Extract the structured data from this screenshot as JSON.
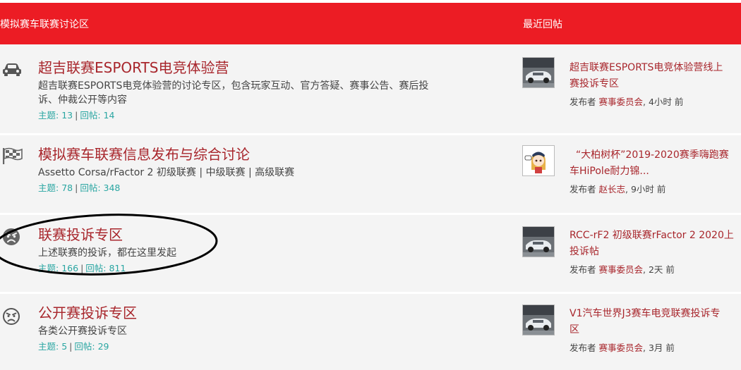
{
  "header": {
    "forum_name": "模拟赛车联赛讨论区",
    "recent_label": "最近回帖"
  },
  "forums": [
    {
      "icon": "car-icon",
      "title": "超吉联赛ESPORTS电竞体验营",
      "description": "超吉联赛ESPORTS电竞体验营的讨论专区，包含玩家互动、官方答疑、赛事公告、赛后投\n诉、仲裁公开等内容",
      "topics_label": "主题:",
      "topics": "13",
      "posts_label": "回帖:",
      "posts": "14",
      "latest": {
        "avatar": "race-car-thumbnail",
        "title": "超吉联赛ESPORTS电竞体验营线上\n赛投诉专区",
        "by_label": "发布者",
        "author": "赛事委员会",
        "time": "4小时 前"
      }
    },
    {
      "icon": "checkered-flag-icon",
      "title": "模拟赛车联赛信息发布与综合讨论",
      "description": "Assetto Corsa/rFactor 2 初级联赛 | 中级联赛 | 高级联赛",
      "topics_label": "主题:",
      "topics": "78",
      "posts_label": "回帖:",
      "posts": "348",
      "latest": {
        "avatar": "anime-girl-avatar",
        "title": "  “大柏树杯”2019-2020赛季嗨跑赛\n车HiPole耐力锦...",
        "by_label": "发布者",
        "author": "赵长志",
        "time": "9小时 前"
      }
    },
    {
      "icon": "angry-face-icon",
      "title": "联赛投诉专区",
      "description": "上述联赛的投诉，都在这里发起",
      "topics_label": "主题:",
      "topics": "166",
      "posts_label": "回帖:",
      "posts": "811",
      "latest": {
        "avatar": "race-car-thumbnail",
        "title": "RCC-rF2 初级联赛rFactor 2 2020上\n投诉帖",
        "by_label": "发布者",
        "author": "赛事委员会",
        "time": "2天 前"
      }
    },
    {
      "icon": "angry-face-outline-icon",
      "title": "公开赛投诉专区",
      "description": "各类公开赛投诉专区",
      "topics_label": "主题:",
      "topics": "5",
      "posts_label": "回帖:",
      "posts": "29",
      "latest": {
        "avatar": "race-car-thumbnail",
        "title": "V1汽车世界J3赛车电竞联赛投诉专\n区",
        "by_label": "发布者",
        "author": "赛事委员会",
        "time": "3月 前"
      }
    }
  ],
  "colors": {
    "header_bg": "#ec1c24",
    "link": "#a8262c",
    "stats": "#2aa6a2",
    "row_bg": "#f4f4f4"
  }
}
